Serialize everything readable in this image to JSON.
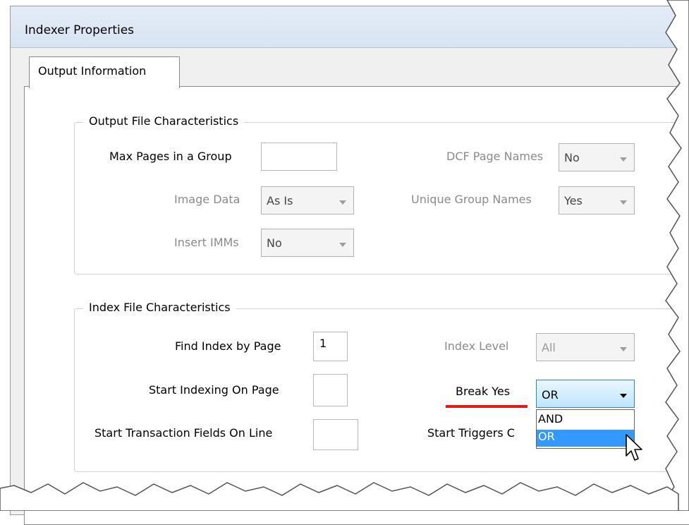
{
  "window": {
    "title": "Indexer Properties"
  },
  "tabs": [
    {
      "label": "Output Information"
    }
  ],
  "output_group": {
    "legend": "Output File Characteristics",
    "max_pages": {
      "label": "Max Pages in a Group",
      "value": ""
    },
    "image_data": {
      "label": "Image Data",
      "value": "As Is"
    },
    "insert_imms": {
      "label": "Insert IMMs",
      "value": "No"
    },
    "dcf_page_names": {
      "label": "DCF Page Names",
      "value": "No"
    },
    "unique_group_names": {
      "label": "Unique Group Names",
      "value": "Yes"
    }
  },
  "index_group": {
    "legend": "Index File Characteristics",
    "find_index_by_page": {
      "label": "Find Index by Page",
      "value": "1"
    },
    "start_indexing_on_page": {
      "label": "Start Indexing On Page",
      "value": ""
    },
    "start_transaction_fields": {
      "label": "Start Transaction Fields On Line",
      "value": ""
    },
    "index_level": {
      "label": "Index Level",
      "value": "All"
    },
    "break_yes": {
      "label": "Break Yes",
      "value": "OR",
      "options": [
        "AND",
        "OR"
      ],
      "highlighted": "OR"
    },
    "start_triggers": {
      "label": "Start Triggers C"
    }
  },
  "colors": {
    "highlight": "#3399ff",
    "annotation_underline": "#e31a1a",
    "disabled_text": "#8b8b8b"
  }
}
